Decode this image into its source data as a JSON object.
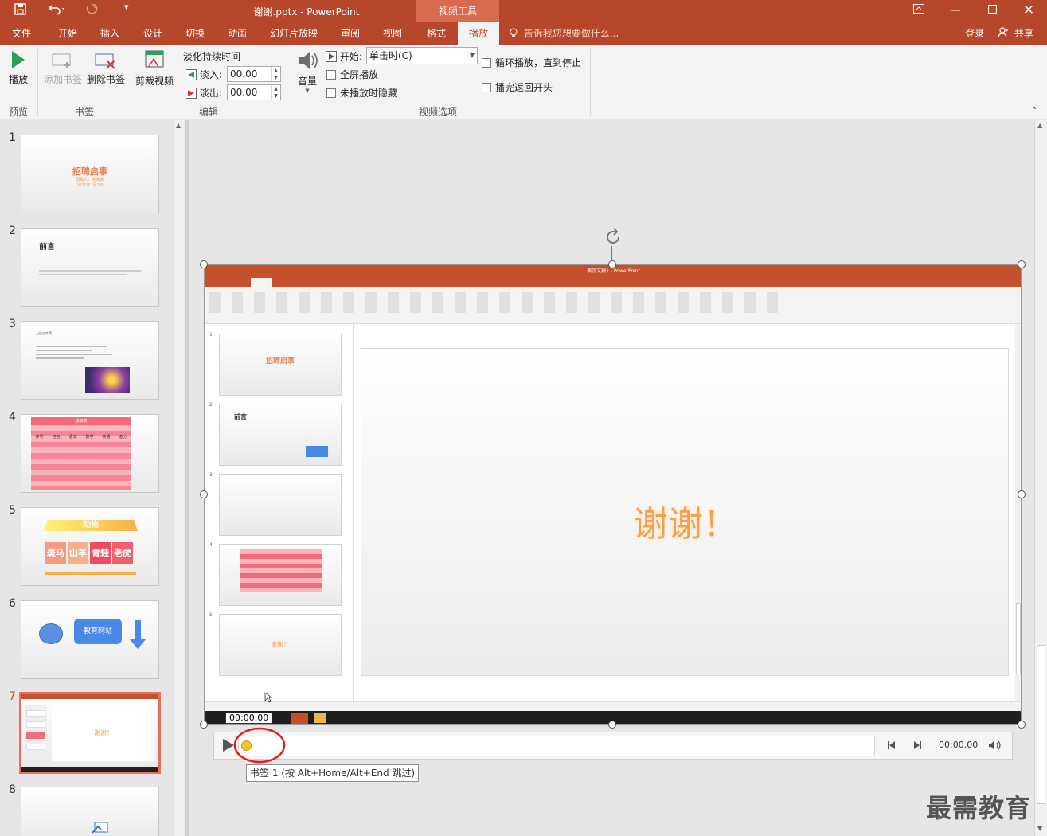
{
  "titlebar": {
    "title": "谢谢.pptx - PowerPoint",
    "context_tab": "视频工具",
    "save_icon": "save-icon",
    "undo_icon": "undo-icon",
    "redo_icon": "redo-icon"
  },
  "tabs": [
    {
      "label": "文件"
    },
    {
      "label": "开始"
    },
    {
      "label": "插入"
    },
    {
      "label": "设计"
    },
    {
      "label": "切换"
    },
    {
      "label": "动画"
    },
    {
      "label": "幻灯片放映"
    },
    {
      "label": "审阅"
    },
    {
      "label": "视图"
    },
    {
      "label": "格式"
    },
    {
      "label": "播放"
    }
  ],
  "tell_me": "告诉我您想要做什么...",
  "login": "登录",
  "share": "共享",
  "ribbon": {
    "play": "播放",
    "add_bookmark": "添加书签",
    "remove_bookmark": "删除书签",
    "trim_video": "剪裁视频",
    "fade_duration": "淡化持续时间",
    "fade_in_label": "淡入:",
    "fade_in_value": "00.00",
    "fade_out_label": "淡出:",
    "fade_out_value": "00.00",
    "volume": "音量",
    "start_label": "开始:",
    "start_value": "单击时(C)",
    "fullscreen": "全屏播放",
    "hide_not_playing": "未播放时隐藏",
    "loop": "循环播放，直到停止",
    "rewind": "播完返回开头",
    "groups": {
      "preview": "预览",
      "bookmark": "书签",
      "edit": "编辑",
      "video_options": "视频选项"
    }
  },
  "slides": [
    {
      "num": "1",
      "title": "招聘启事",
      "sub1": "招聘人：某某某",
      "sub2": "2021年1月1日"
    },
    {
      "num": "2",
      "title": "前言"
    },
    {
      "num": "3",
      "title": "上班工作简"
    },
    {
      "num": "4",
      "title": "成绩表",
      "headers": [
        "序号",
        "姓名",
        "语文",
        "数学",
        "英语",
        "总分"
      ]
    },
    {
      "num": "5",
      "title": "动物",
      "animals": [
        "斑马",
        "山羊",
        "青蛙",
        "老虎"
      ]
    },
    {
      "num": "6",
      "label": "教育网站"
    },
    {
      "num": "7",
      "title": "谢谢！"
    },
    {
      "num": "8"
    }
  ],
  "video": {
    "main_text": "谢谢！",
    "inner_title": "演示文稿1 - PowerPoint",
    "time_label": "00:00.00",
    "inner_thumbs": [
      {
        "num": "1",
        "title": "招聘启事"
      },
      {
        "num": "2",
        "title": "前言"
      },
      {
        "num": "3"
      },
      {
        "num": "4"
      },
      {
        "num": "5",
        "title": "谢谢！"
      }
    ]
  },
  "controls": {
    "time": "00:00.00",
    "progress_fraction": 0.0
  },
  "tooltip": "书签 1 (按 Alt+Home/Alt+End 跳过)",
  "watermark": "最需教育",
  "colors": {
    "accent": "#b7472a",
    "highlight_circle": "#e02020",
    "bookmark": "#f7c325"
  }
}
